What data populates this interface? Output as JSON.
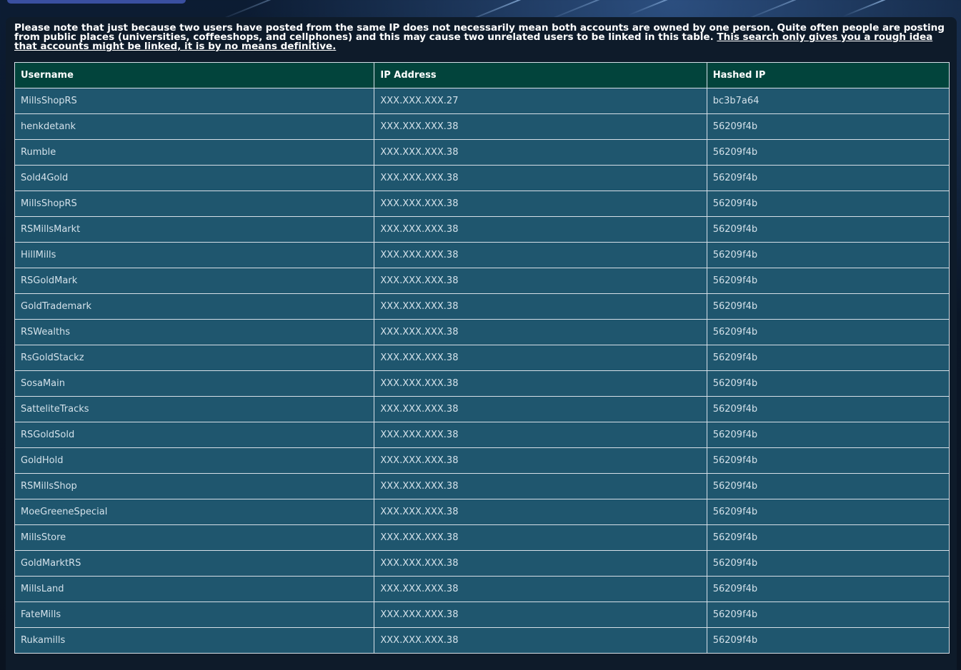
{
  "notice": {
    "text": "Please note that just because two users have posted from the same IP does not necessarily mean both accounts are owned by one person. Quite often people are posting from public places (universities, coffeeshops, and cellphones) and this may cause two unrelated users to be linked in this table. ",
    "link_text": "This search only gives you a rough idea that accounts might be linked, it is by no means definitive."
  },
  "table": {
    "headers": [
      "Username",
      "IP Address",
      "Hashed IP"
    ],
    "rows": [
      [
        "MillsShopRS",
        "XXX.XXX.XXX.27",
        "bc3b7a64"
      ],
      [
        "henkdetank",
        "XXX.XXX.XXX.38",
        "56209f4b"
      ],
      [
        "Rumble",
        "XXX.XXX.XXX.38",
        "56209f4b"
      ],
      [
        "Sold4Gold",
        "XXX.XXX.XXX.38",
        "56209f4b"
      ],
      [
        "MillsShopRS",
        "XXX.XXX.XXX.38",
        "56209f4b"
      ],
      [
        "RSMillsMarkt",
        "XXX.XXX.XXX.38",
        "56209f4b"
      ],
      [
        "HillMills",
        "XXX.XXX.XXX.38",
        "56209f4b"
      ],
      [
        "RSGoldMark",
        "XXX.XXX.XXX.38",
        "56209f4b"
      ],
      [
        "GoldTrademark",
        "XXX.XXX.XXX.38",
        "56209f4b"
      ],
      [
        "RSWealths",
        "XXX.XXX.XXX.38",
        "56209f4b"
      ],
      [
        "RsGoldStackz",
        "XXX.XXX.XXX.38",
        "56209f4b"
      ],
      [
        "SosaMain",
        "XXX.XXX.XXX.38",
        "56209f4b"
      ],
      [
        "SatteliteTracks",
        "XXX.XXX.XXX.38",
        "56209f4b"
      ],
      [
        "RSGoldSold",
        "XXX.XXX.XXX.38",
        "56209f4b"
      ],
      [
        "GoldHold",
        "XXX.XXX.XXX.38",
        "56209f4b"
      ],
      [
        "RSMillsShop",
        "XXX.XXX.XXX.38",
        "56209f4b"
      ],
      [
        "MoeGreeneSpecial",
        "XXX.XXX.XXX.38",
        "56209f4b"
      ],
      [
        "MillsStore",
        "XXX.XXX.XXX.38",
        "56209f4b"
      ],
      [
        "GoldMarktRS",
        "XXX.XXX.XXX.38",
        "56209f4b"
      ],
      [
        "MillsLand",
        "XXX.XXX.XXX.38",
        "56209f4b"
      ],
      [
        "FateMills",
        "XXX.XXX.XXX.38",
        "56209f4b"
      ],
      [
        "Rukamills",
        "XXX.XXX.XXX.38",
        "56209f4b"
      ]
    ]
  },
  "colors": {
    "header_bg": "#02443c",
    "row_bg": "#1f566e",
    "panel_bg": "#0e1b2a",
    "text": "#d3e1ea"
  }
}
